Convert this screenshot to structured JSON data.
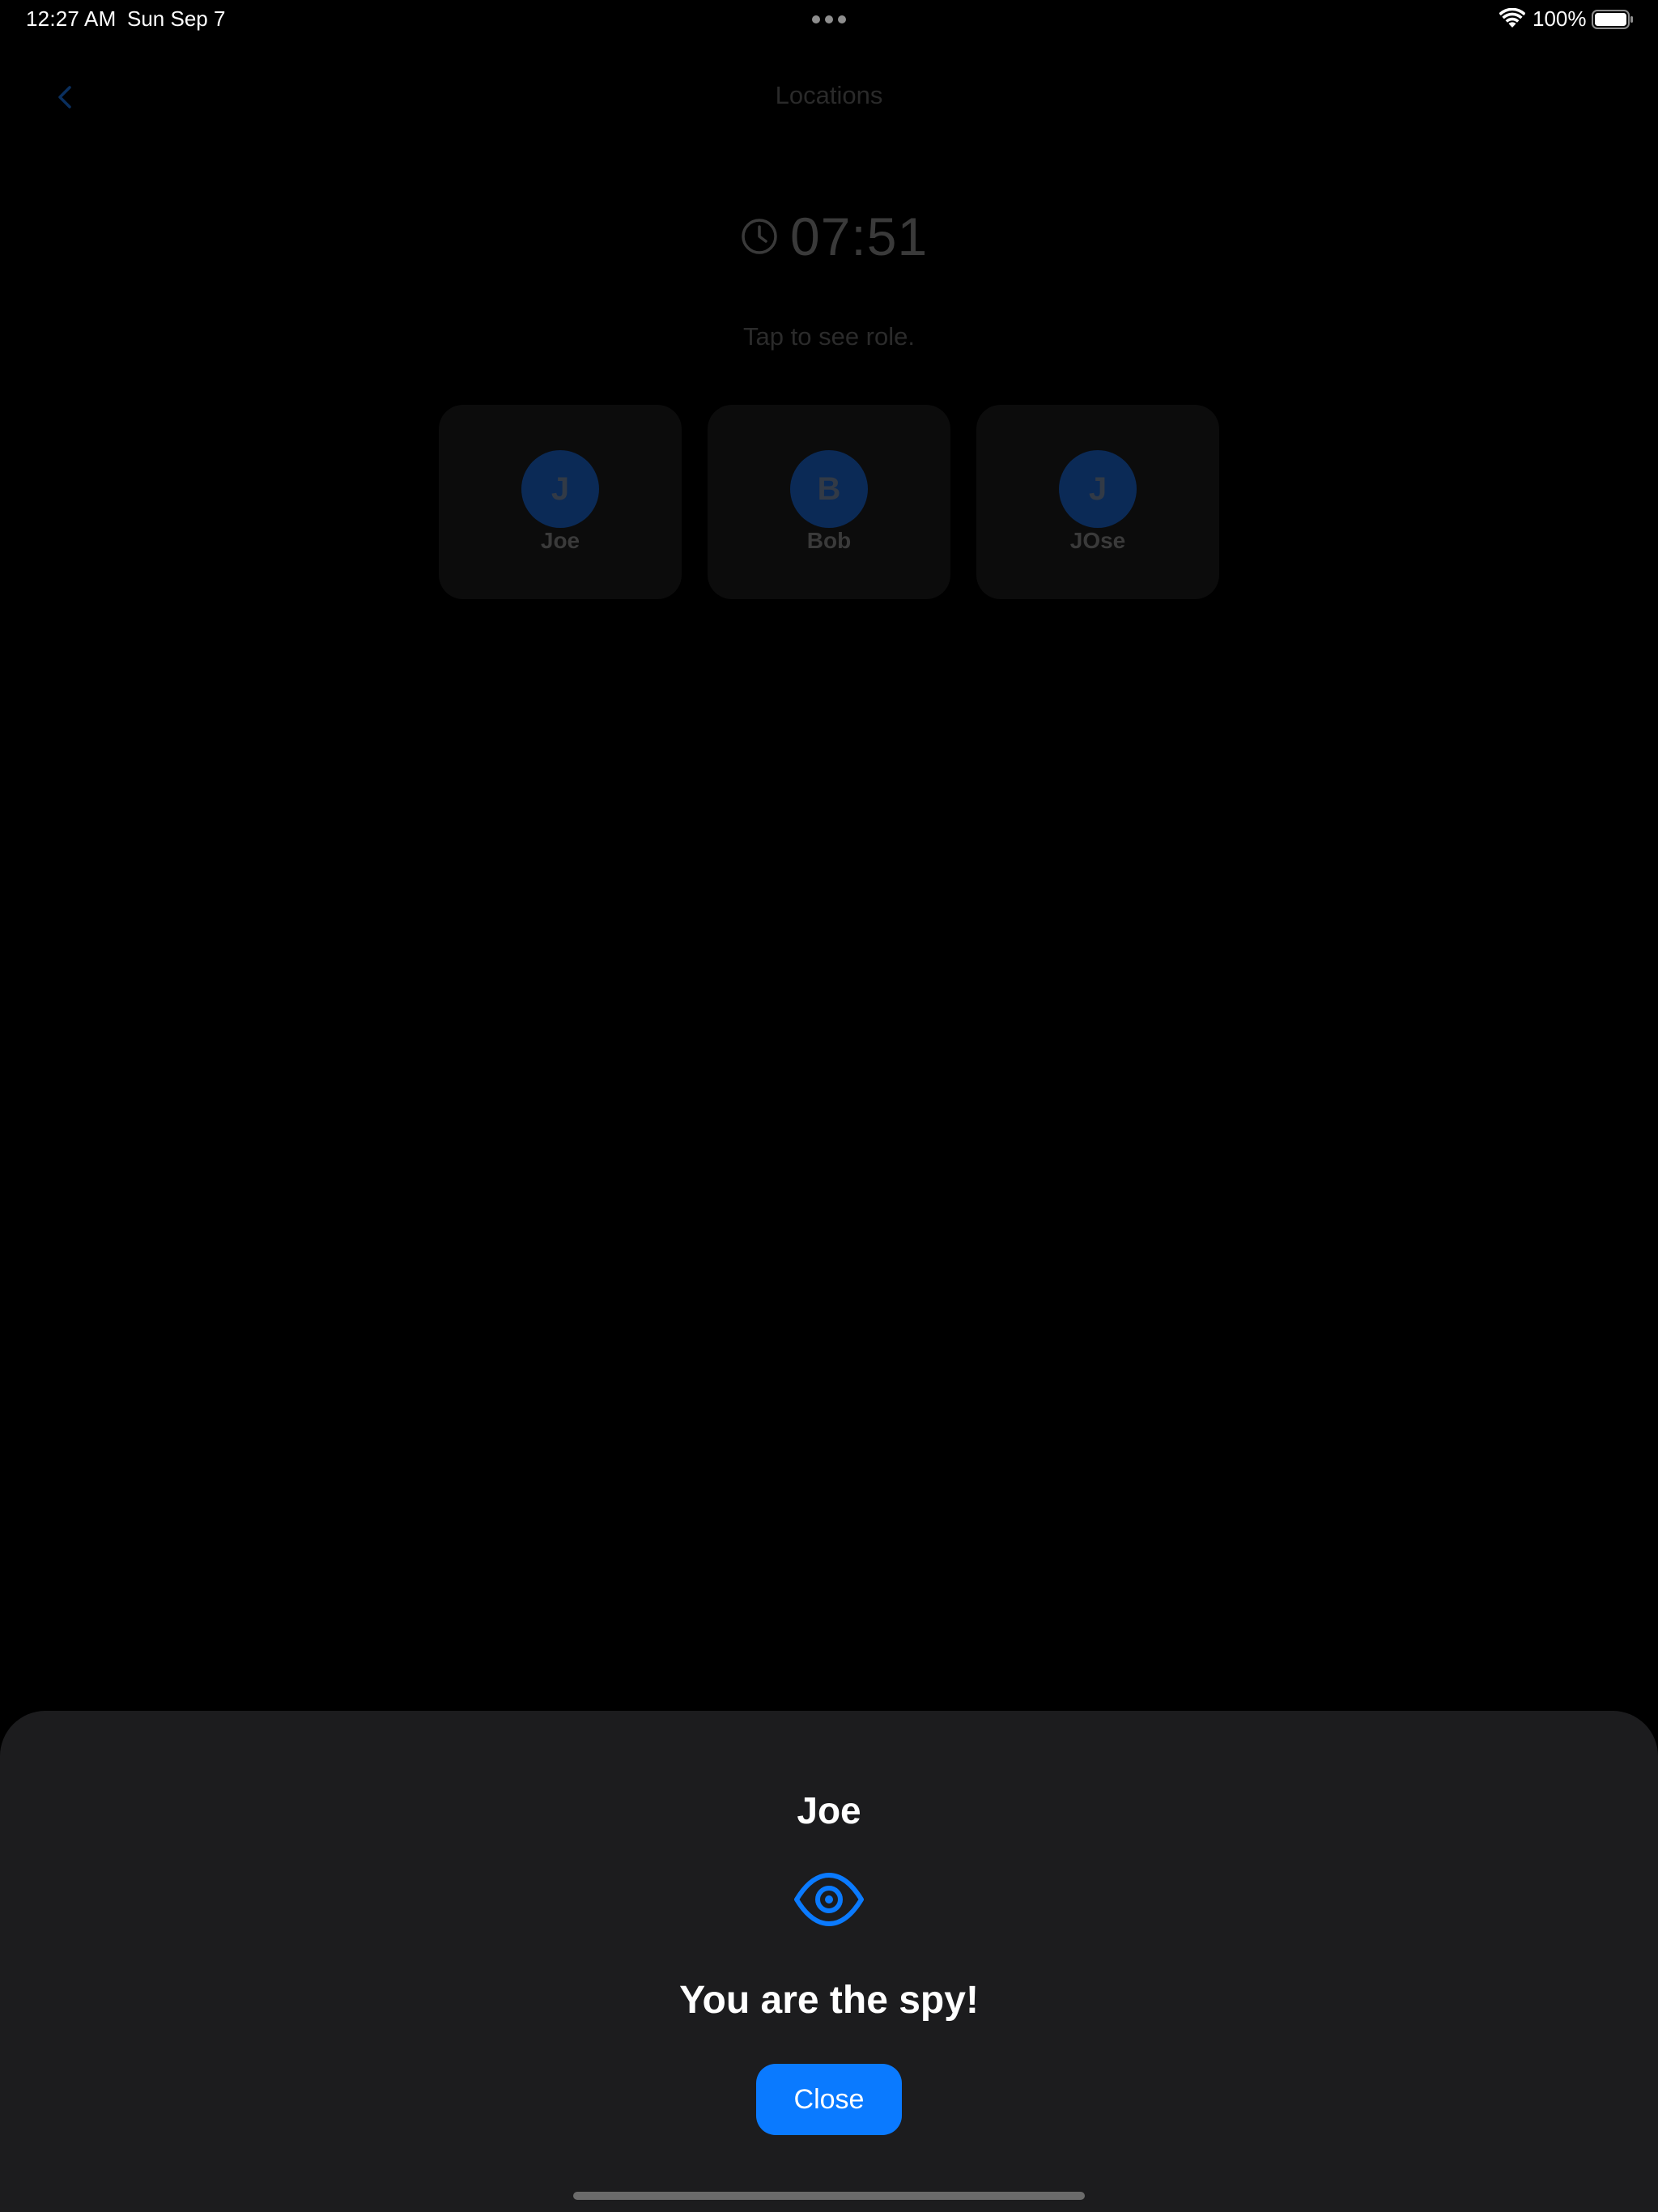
{
  "status_bar": {
    "time": "12:27 AM",
    "date": "Sun Sep 7",
    "battery": "100%",
    "icons": [
      "wifi-icon",
      "battery-icon",
      "multitask-dots-icon"
    ]
  },
  "nav": {
    "title": "Locations",
    "back_icon": "chevron-left-icon"
  },
  "timer": {
    "value": "07:51",
    "icon": "clock-icon"
  },
  "hint": "Tap to see role.",
  "players": [
    {
      "initial": "J",
      "name": "Joe"
    },
    {
      "initial": "B",
      "name": "Bob"
    },
    {
      "initial": "J",
      "name": "JOse"
    }
  ],
  "sheet": {
    "player_name": "Joe",
    "icon": "eye-icon",
    "role_text": "You are the spy!",
    "close_label": "Close"
  },
  "colors": {
    "accent": "#0a7aff",
    "sheet_background": "#1c1c1e",
    "background": "#000000",
    "avatar_dimmed": "#0b2a56"
  }
}
